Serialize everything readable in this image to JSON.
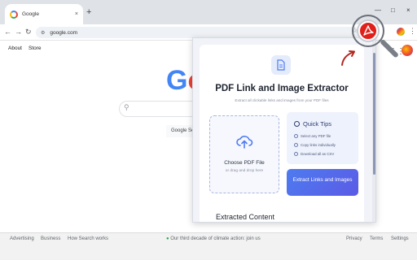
{
  "browser": {
    "tab_title": "Google",
    "tab_close": "×",
    "new_tab": "+",
    "url": "google.com",
    "win_min": "—",
    "win_max": "□",
    "win_close": "×"
  },
  "google": {
    "nav_left": [
      "About",
      "Store"
    ],
    "logo_letters": [
      "G",
      "o"
    ],
    "search_button": "Google Search",
    "footer_left": [
      "Advertising",
      "Business",
      "How Search works"
    ],
    "footer_center": "Our third decade of climate action: join us",
    "footer_right": [
      "Privacy",
      "Terms",
      "Settings"
    ]
  },
  "extension": {
    "title": "PDF Link and Image Extractor",
    "subtitle": "Extract all clickable links and images from your PDF files",
    "upload_title": "Choose PDF File",
    "upload_subtitle": "or drag and drop here",
    "tips_title": "Quick Tips",
    "tips": [
      "Select any PDF file",
      "Copy links individually",
      "Download all as CSV"
    ],
    "extract_button": "Extract Links and Images",
    "extracted_heading": "Extracted Content"
  },
  "icons": {
    "accent": "#4e7bf0",
    "pdf_red": "#e0201a"
  }
}
